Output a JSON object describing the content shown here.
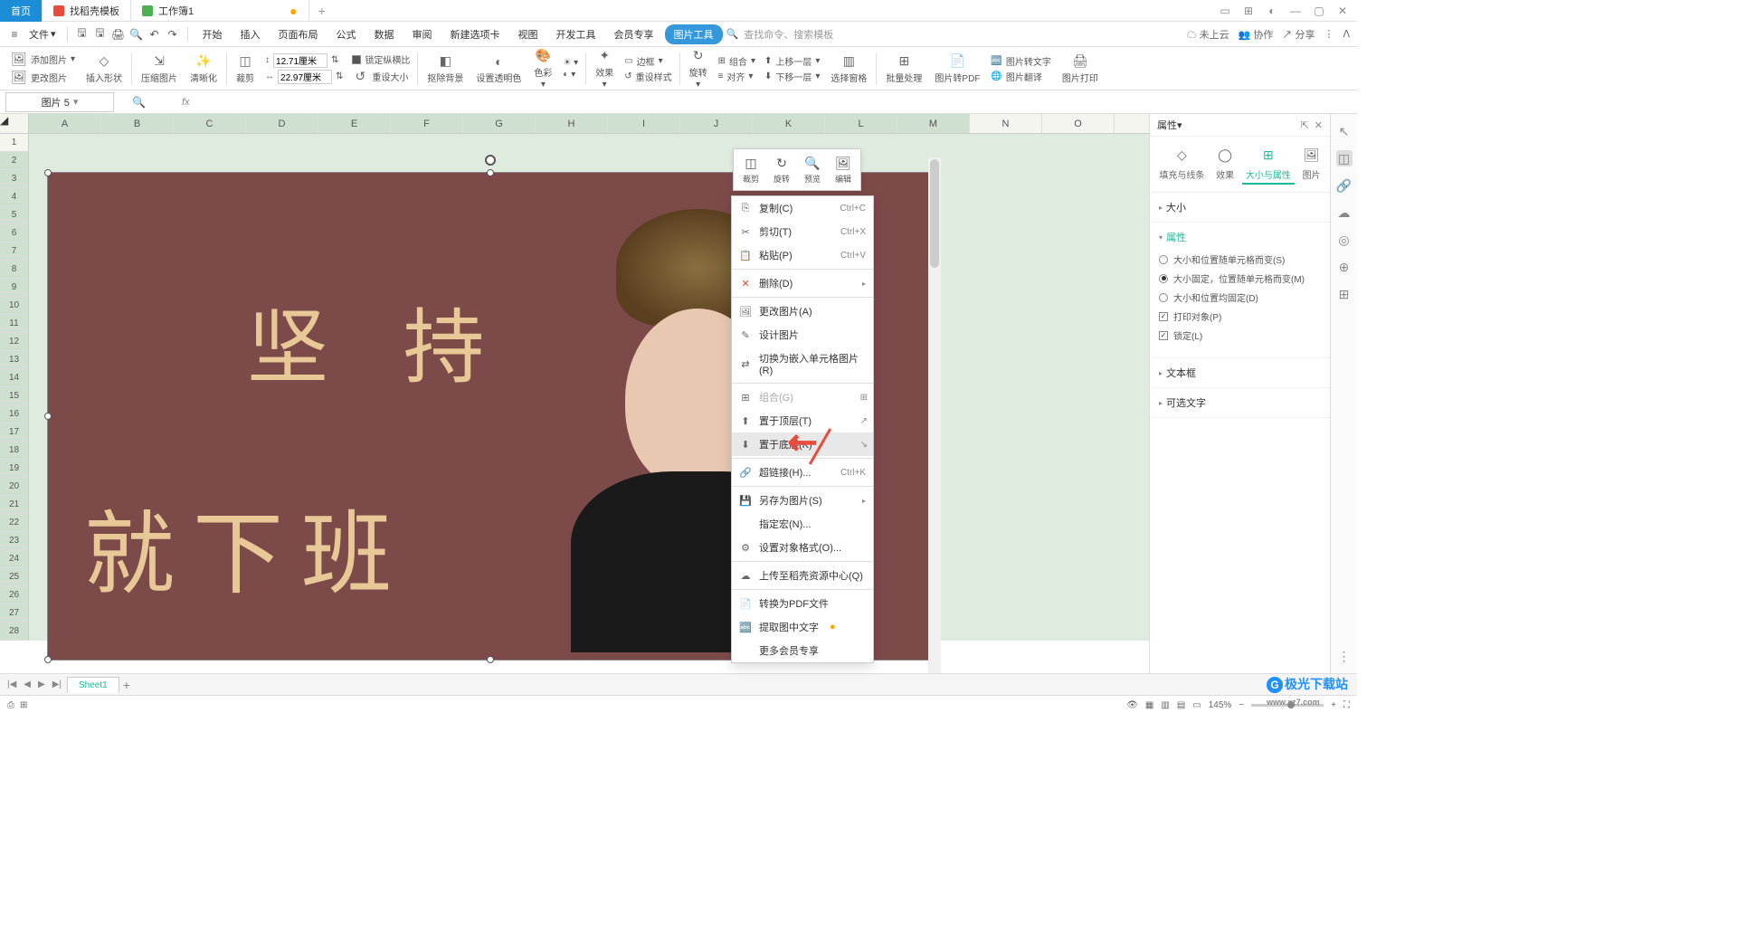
{
  "titlebar": {
    "tabs": [
      {
        "label": "首页",
        "type": "home"
      },
      {
        "label": "找稻壳模板",
        "type": "red"
      },
      {
        "label": "工作簿1",
        "type": "green",
        "modified": true
      }
    ]
  },
  "menubar": {
    "file": "文件",
    "items": [
      "开始",
      "插入",
      "页面布局",
      "公式",
      "数据",
      "审阅",
      "新建选项卡",
      "视图",
      "开发工具",
      "会员专享",
      "图片工具"
    ],
    "search_hint": "查找命令、搜索模板",
    "right": [
      "未上云",
      "协作",
      "分享"
    ]
  },
  "ribbon": {
    "add_image": "添加图片",
    "change_image": "更改图片",
    "insert_shape": "插入形状",
    "compress": "压缩图片",
    "clarity": "清晰化",
    "crop": "裁剪",
    "width": "12.71厘米",
    "height": "22.97厘米",
    "lock_ratio": "锁定纵横比",
    "reset_size": "重设大小",
    "remove_bg": "抠除背景",
    "transparency": "设置透明色",
    "color": "色彩",
    "effects": "效果",
    "reset_style": "重设样式",
    "border": "边框",
    "rotate": "旋转",
    "align": "对齐",
    "group": "组合",
    "bring_forward": "上移一层",
    "send_backward": "下移一层",
    "select_pane": "选择窗格",
    "batch": "批量处理",
    "to_pdf": "图片转PDF",
    "to_text": "图片转文字",
    "translate": "图片翻译",
    "print": "图片打印"
  },
  "formula": {
    "name_box": "图片 5",
    "fx": "fx"
  },
  "sheet": {
    "columns": [
      "A",
      "B",
      "C",
      "D",
      "E",
      "F",
      "G",
      "H",
      "I",
      "J",
      "K",
      "L",
      "M",
      "N",
      "O"
    ],
    "rows": [
      1,
      2,
      3,
      4,
      5,
      6,
      7,
      8,
      9,
      10,
      11,
      12,
      13,
      14,
      15,
      16,
      17,
      18,
      19,
      20,
      21,
      22,
      23,
      24,
      25,
      26,
      27,
      28
    ],
    "sheet_name": "Sheet1"
  },
  "image": {
    "text1": "坚 持",
    "text2": "就下班"
  },
  "float_toolbar": {
    "crop": "裁剪",
    "rotate": "旋转",
    "preview": "预览",
    "edit": "编辑"
  },
  "context_menu": [
    {
      "label": "复制(C)",
      "shortcut": "Ctrl+C",
      "icon": "⎘"
    },
    {
      "label": "剪切(T)",
      "shortcut": "Ctrl+X",
      "icon": "✂"
    },
    {
      "label": "粘贴(P)",
      "shortcut": "Ctrl+V",
      "icon": "📋"
    },
    {
      "sep": true
    },
    {
      "label": "删除(D)",
      "arrow": true,
      "icon": "✕",
      "red": true
    },
    {
      "sep": true
    },
    {
      "label": "更改图片(A)",
      "icon": "🖼"
    },
    {
      "label": "设计图片",
      "icon": "✎"
    },
    {
      "label": "切换为嵌入单元格图片(R)",
      "icon": "⇄"
    },
    {
      "sep": true
    },
    {
      "label": "组合(G)",
      "disabled": true,
      "icon": "⊞",
      "extra": "⊞"
    },
    {
      "label": "置于顶层(T)",
      "icon": "⬆",
      "extra": "↗"
    },
    {
      "label": "置于底层(K)",
      "icon": "⬇",
      "hover": true,
      "extra": "↘"
    },
    {
      "sep": true
    },
    {
      "label": "超链接(H)...",
      "shortcut": "Ctrl+K",
      "icon": "🔗"
    },
    {
      "sep": true
    },
    {
      "label": "另存为图片(S)",
      "arrow": true,
      "icon": "💾"
    },
    {
      "label": "指定宏(N)...",
      "icon": ""
    },
    {
      "label": "设置对象格式(O)...",
      "icon": "⚙"
    },
    {
      "sep": true
    },
    {
      "label": "上传至稻壳资源中心(Q)",
      "icon": "☁"
    },
    {
      "sep": true
    },
    {
      "label": "转换为PDF文件",
      "icon": "📄"
    },
    {
      "label": "提取图中文字",
      "icon": "🔤",
      "badge": true
    },
    {
      "label": "更多会员专享",
      "icon": ""
    }
  ],
  "panel": {
    "title": "属性",
    "tabs": [
      "填充与线条",
      "效果",
      "大小与属性",
      "图片"
    ],
    "section_size": "大小",
    "section_props": "属性",
    "section_textbox": "文本框",
    "section_alt": "可选文字",
    "opt1": "大小和位置随单元格而变(S)",
    "opt2": "大小固定，位置随单元格而变(M)",
    "opt3": "大小和位置均固定(D)",
    "chk1": "打印对象(P)",
    "chk2": "锁定(L)"
  },
  "status": {
    "zoom": "145%"
  },
  "watermark": {
    "title": "极光下载站",
    "url": "www.xz7.com"
  }
}
